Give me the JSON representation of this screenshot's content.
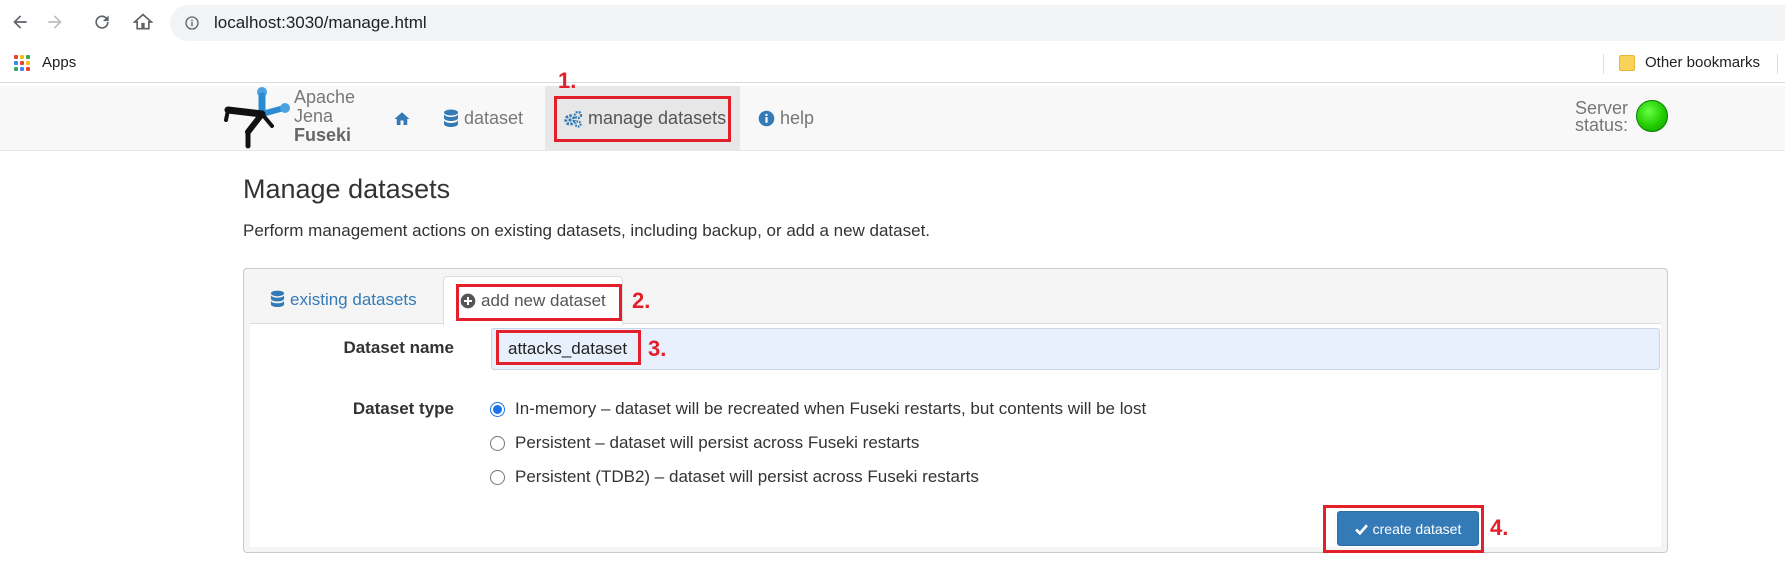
{
  "browser": {
    "url": "localhost:3030/manage.html",
    "apps_label": "Apps",
    "other_bookmarks_label": "Other bookmarks",
    "apps_colors": [
      "#ea4335",
      "#fbbc05",
      "#34a853",
      "#4285f4",
      "#ea4335",
      "#fbbc05",
      "#34a853",
      "#4285f4",
      "#ea4335"
    ]
  },
  "navbar": {
    "logo_line1": "Apache",
    "logo_line2": "Jena",
    "logo_line3": "Fuseki",
    "home_icon": "home-icon",
    "dataset_label": "dataset",
    "manage_label": "manage datasets",
    "help_label": "help",
    "server_status_line1": "Server",
    "server_status_line2": "status:",
    "server_status_color": "#22cc00"
  },
  "page": {
    "title": "Manage datasets",
    "description": "Perform management actions on existing datasets, including backup, or add a new dataset."
  },
  "tabs": [
    {
      "label": "existing datasets",
      "icon": "database-icon",
      "active": false
    },
    {
      "label": "add new dataset",
      "icon": "plus-circle-icon",
      "active": true
    }
  ],
  "form": {
    "dataset_name_label": "Dataset name",
    "dataset_name_value": "attacks_dataset",
    "dataset_type_label": "Dataset type",
    "options": [
      {
        "label": "In-memory – dataset will be recreated when Fuseki restarts, but contents will be lost",
        "checked": true
      },
      {
        "label": "Persistent – dataset will persist across Fuseki restarts",
        "checked": false
      },
      {
        "label": "Persistent (TDB2) – dataset will persist across Fuseki restarts",
        "checked": false
      }
    ],
    "create_button_label": "create dataset"
  },
  "callouts": [
    "1.",
    "2.",
    "3.",
    "4."
  ],
  "colors": {
    "accent": "#337ab7",
    "callout": "#e3202a"
  }
}
